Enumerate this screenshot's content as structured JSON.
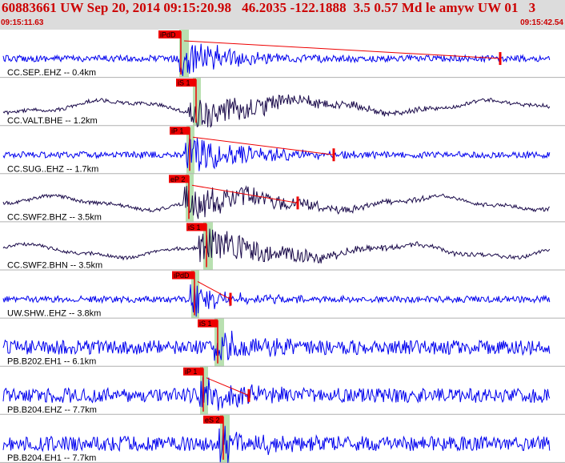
{
  "header": {
    "title": "60883661 UW Sep 20, 2014 09:15:20.98   46.2035 -122.1888  3.5 0.57 Md le amyw UW 01   3",
    "time_start": "09:15:11.63",
    "time_end": "09:15:42.54"
  },
  "colors": {
    "title": "#cc0000",
    "header_bg": "#dcdcdc",
    "trace_blue": "#0000ee",
    "trace_dark": "#1a0a4a",
    "pick": "#ee0000",
    "window": "#b8e0b0"
  },
  "chart_data": {
    "type": "line",
    "x_unit": "time",
    "xlim": [
      "09:15:11.63",
      "09:15:42.54"
    ],
    "traces": [
      {
        "label": "CC.SEP..EHZ -- 0.4km",
        "color": "blue",
        "picks": [
          {
            "label": "iPdD"
          }
        ]
      },
      {
        "label": "CC.VALT.BHE -- 1.2km",
        "color": "dark",
        "picks": [
          {
            "label": "iS 1"
          }
        ]
      },
      {
        "label": "CC.SUG..EHZ -- 1.7km",
        "color": "blue",
        "picks": [
          {
            "label": "iP 1"
          }
        ]
      },
      {
        "label": "CC.SWF2.BHZ -- 3.5km",
        "color": "dark",
        "picks": [
          {
            "label": "eP 2"
          }
        ]
      },
      {
        "label": "CC.SWF2.BHN -- 3.5km",
        "color": "dark",
        "picks": [
          {
            "label": "iS 1"
          }
        ]
      },
      {
        "label": "UW.SHW..EHZ -- 3.8km",
        "color": "blue",
        "picks": [
          {
            "label": "iPdD"
          }
        ]
      },
      {
        "label": "PB.B202.EH1 -- 6.1km",
        "color": "blue",
        "picks": [
          {
            "label": "iS 1"
          }
        ]
      },
      {
        "label": "PB.B204.EHZ -- 7.7km",
        "color": "blue",
        "picks": [
          {
            "label": "iP 1"
          }
        ]
      },
      {
        "label": "PB.B204.EH1 -- 7.7km",
        "color": "blue",
        "picks": [
          {
            "label": "eS 2"
          }
        ]
      }
    ]
  }
}
